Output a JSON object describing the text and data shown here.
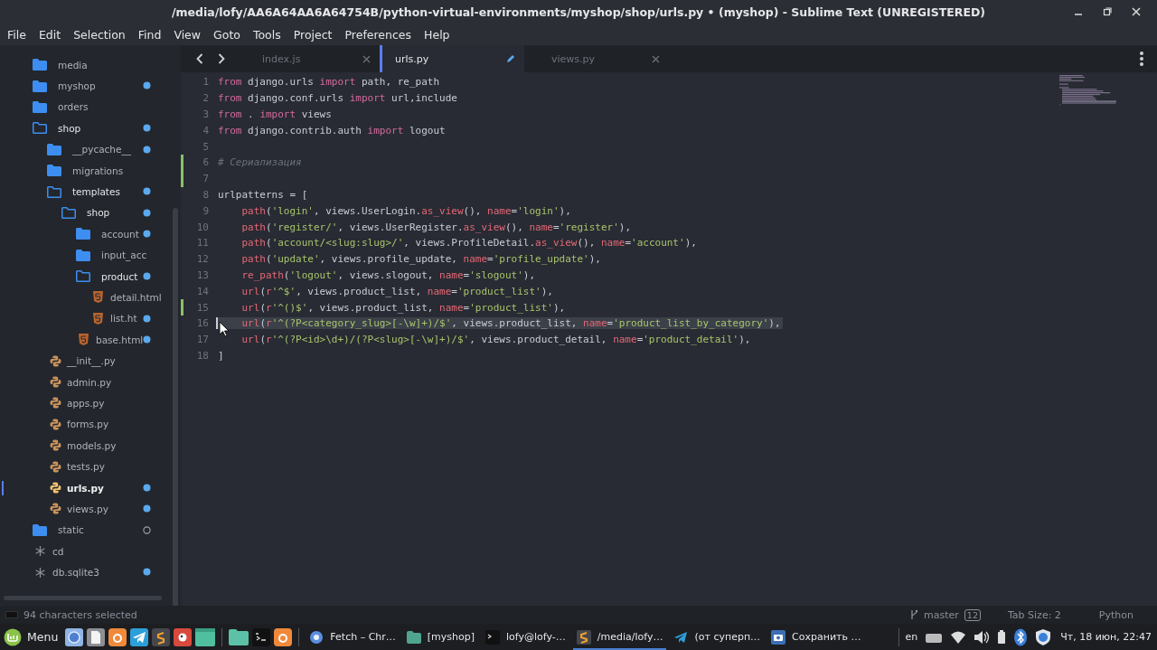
{
  "window": {
    "title": "/media/lofy/AA6A64AA6A64754B/python-virtual-environments/myshop/shop/urls.py • (myshop) - Sublime Text (UNREGISTERED)"
  },
  "menu": [
    "File",
    "Edit",
    "Selection",
    "Find",
    "View",
    "Goto",
    "Tools",
    "Project",
    "Preferences",
    "Help"
  ],
  "sidebar": {
    "items": [
      {
        "label": "media",
        "kind": "folder",
        "modified": false,
        "untracked": false,
        "selected": false
      },
      {
        "label": "myshop",
        "kind": "folder",
        "modified": true,
        "untracked": false,
        "selected": false
      },
      {
        "label": "orders",
        "kind": "folder",
        "modified": false,
        "untracked": false,
        "selected": false
      },
      {
        "label": "shop",
        "kind": "folder_open",
        "modified": true,
        "untracked": false,
        "selected": false,
        "children": [
          {
            "label": "__pycache__",
            "kind": "folder",
            "modified": true,
            "untracked": false,
            "selected": false
          },
          {
            "label": "migrations",
            "kind": "folder",
            "modified": false,
            "untracked": false,
            "selected": false
          },
          {
            "label": "templates",
            "kind": "folder_open",
            "modified": true,
            "untracked": false,
            "selected": false,
            "children": [
              {
                "label": "shop",
                "kind": "folder_open",
                "modified": true,
                "untracked": false,
                "selected": false,
                "children": [
                  {
                    "label": "account",
                    "kind": "folder",
                    "modified": true,
                    "untracked": false,
                    "selected": false
                  },
                  {
                    "label": "input_acc",
                    "kind": "folder",
                    "modified": false,
                    "untracked": false,
                    "selected": false
                  },
                  {
                    "label": "product",
                    "kind": "folder_open",
                    "modified": true,
                    "untracked": false,
                    "selected": false,
                    "children": [
                      {
                        "label": "detail.html",
                        "kind": "html",
                        "modified": false,
                        "untracked": false,
                        "selected": false
                      },
                      {
                        "label": "list.ht",
                        "kind": "html",
                        "modified": true,
                        "untracked": false,
                        "selected": false
                      }
                    ]
                  },
                  {
                    "label": "base.html",
                    "kind": "html",
                    "modified": true,
                    "untracked": false,
                    "selected": false
                  }
                ]
              }
            ]
          },
          {
            "label": "__init__.py",
            "kind": "python",
            "modified": false,
            "untracked": false,
            "selected": false
          },
          {
            "label": "admin.py",
            "kind": "python",
            "modified": false,
            "untracked": false,
            "selected": false
          },
          {
            "label": "apps.py",
            "kind": "python",
            "modified": false,
            "untracked": false,
            "selected": false
          },
          {
            "label": "forms.py",
            "kind": "python",
            "modified": false,
            "untracked": false,
            "selected": false
          },
          {
            "label": "models.py",
            "kind": "python",
            "modified": false,
            "untracked": false,
            "selected": false
          },
          {
            "label": "tests.py",
            "kind": "python",
            "modified": false,
            "untracked": false,
            "selected": false
          },
          {
            "label": "urls.py",
            "kind": "python",
            "modified": true,
            "untracked": false,
            "selected": true
          },
          {
            "label": "views.py",
            "kind": "python",
            "modified": true,
            "untracked": false,
            "selected": false
          }
        ]
      },
      {
        "label": "static",
        "kind": "folder",
        "modified": false,
        "untracked": true,
        "selected": false
      },
      {
        "label": "cd",
        "kind": "file",
        "modified": false,
        "untracked": false,
        "selected": false
      },
      {
        "label": "db.sqlite3",
        "kind": "file",
        "modified": true,
        "untracked": false,
        "selected": false
      }
    ]
  },
  "tabs": [
    {
      "label": "index.js",
      "selected": false,
      "modified": false
    },
    {
      "label": "urls.py",
      "selected": true,
      "modified": true
    },
    {
      "label": "views.py",
      "selected": false,
      "modified": false
    }
  ],
  "editor": {
    "lines": [
      {
        "number": "1",
        "changed": false,
        "segments": [
          {
            "kind": "kw",
            "text": "from"
          },
          {
            "kind": "plain",
            "text": " django.urls "
          },
          {
            "kind": "kw",
            "text": "import"
          },
          {
            "kind": "plain",
            "text": " path, re_path"
          }
        ]
      },
      {
        "number": "2",
        "changed": false,
        "segments": [
          {
            "kind": "kw",
            "text": "from"
          },
          {
            "kind": "plain",
            "text": " django.conf.urls "
          },
          {
            "kind": "kw",
            "text": "import"
          },
          {
            "kind": "plain",
            "text": " url,include"
          }
        ]
      },
      {
        "number": "3",
        "changed": false,
        "segments": [
          {
            "kind": "kw",
            "text": "from"
          },
          {
            "kind": "plain",
            "text": " . "
          },
          {
            "kind": "kw",
            "text": "import"
          },
          {
            "kind": "plain",
            "text": " views"
          }
        ]
      },
      {
        "number": "4",
        "changed": false,
        "segments": [
          {
            "kind": "kw",
            "text": "from"
          },
          {
            "kind": "plain",
            "text": " django.contrib.auth "
          },
          {
            "kind": "kw",
            "text": "import"
          },
          {
            "kind": "plain",
            "text": " logout"
          }
        ]
      },
      {
        "number": "5",
        "changed": false
      },
      {
        "number": "6",
        "changed": true,
        "segments": [
          {
            "kind": "comment",
            "text": "# Сериализация"
          }
        ]
      },
      {
        "number": "7",
        "changed": true
      },
      {
        "number": "8",
        "changed": false,
        "segments": [
          {
            "kind": "plain",
            "text": "urlpatterns = ["
          }
        ]
      },
      {
        "number": "9",
        "changed": false,
        "indented": true,
        "segments": [
          {
            "kind": "fn",
            "text": "path"
          },
          {
            "kind": "plain",
            "text": "("
          },
          {
            "kind": "str",
            "text": "'login'"
          },
          {
            "kind": "plain",
            "text": ", views.UserLogin."
          },
          {
            "kind": "fn",
            "text": "as_view"
          },
          {
            "kind": "plain",
            "text": "(), "
          },
          {
            "kind": "fn",
            "text": "name"
          },
          {
            "kind": "plain",
            "text": "="
          },
          {
            "kind": "str",
            "text": "'login'"
          },
          {
            "kind": "plain",
            "text": "),"
          }
        ]
      },
      {
        "number": "10",
        "changed": false,
        "indented": true,
        "segments": [
          {
            "kind": "fn",
            "text": "path"
          },
          {
            "kind": "plain",
            "text": "("
          },
          {
            "kind": "str",
            "text": "'register/'"
          },
          {
            "kind": "plain",
            "text": ", views.UserRegister."
          },
          {
            "kind": "fn",
            "text": "as_view"
          },
          {
            "kind": "plain",
            "text": "(), "
          },
          {
            "kind": "fn",
            "text": "name"
          },
          {
            "kind": "plain",
            "text": "="
          },
          {
            "kind": "str",
            "text": "'register'"
          },
          {
            "kind": "plain",
            "text": "),"
          }
        ]
      },
      {
        "number": "11",
        "changed": false,
        "indented": true,
        "segments": [
          {
            "kind": "fn",
            "text": "path"
          },
          {
            "kind": "plain",
            "text": "("
          },
          {
            "kind": "str",
            "text": "'account/<slug:slug>/'"
          },
          {
            "kind": "plain",
            "text": ", views.ProfileDetail."
          },
          {
            "kind": "fn",
            "text": "as_view"
          },
          {
            "kind": "plain",
            "text": "(), "
          },
          {
            "kind": "fn",
            "text": "name"
          },
          {
            "kind": "plain",
            "text": "="
          },
          {
            "kind": "str",
            "text": "'account'"
          },
          {
            "kind": "plain",
            "text": "),"
          }
        ]
      },
      {
        "number": "12",
        "changed": false,
        "indented": true,
        "segments": [
          {
            "kind": "fn",
            "text": "path"
          },
          {
            "kind": "plain",
            "text": "("
          },
          {
            "kind": "str",
            "text": "'update'"
          },
          {
            "kind": "plain",
            "text": ", views.profile_update, "
          },
          {
            "kind": "fn",
            "text": "name"
          },
          {
            "kind": "plain",
            "text": "="
          },
          {
            "kind": "str",
            "text": "'profile_update'"
          },
          {
            "kind": "plain",
            "text": "),"
          }
        ]
      },
      {
        "number": "13",
        "changed": false,
        "indented": true,
        "segments": [
          {
            "kind": "fn",
            "text": "re_path"
          },
          {
            "kind": "plain",
            "text": "("
          },
          {
            "kind": "str",
            "text": "'logout'"
          },
          {
            "kind": "plain",
            "text": ", views.slogout, "
          },
          {
            "kind": "fn",
            "text": "name"
          },
          {
            "kind": "plain",
            "text": "="
          },
          {
            "kind": "str",
            "text": "'slogout'"
          },
          {
            "kind": "plain",
            "text": "),"
          }
        ]
      },
      {
        "number": "14",
        "changed": false,
        "indented": true,
        "segments": [
          {
            "kind": "fn",
            "text": "url"
          },
          {
            "kind": "plain",
            "text": "("
          },
          {
            "kind": "fn",
            "text": "r"
          },
          {
            "kind": "str",
            "text": "'^$'"
          },
          {
            "kind": "plain",
            "text": ", views.product_list, "
          },
          {
            "kind": "fn",
            "text": "name"
          },
          {
            "kind": "plain",
            "text": "="
          },
          {
            "kind": "str",
            "text": "'product_list'"
          },
          {
            "kind": "plain",
            "text": "),"
          }
        ]
      },
      {
        "number": "15",
        "changed": true,
        "indented": true,
        "segments": [
          {
            "kind": "fn",
            "text": "url"
          },
          {
            "kind": "plain",
            "text": "("
          },
          {
            "kind": "fn",
            "text": "r"
          },
          {
            "kind": "str",
            "text": "'^()$'"
          },
          {
            "kind": "plain",
            "text": ", views.product_list, "
          },
          {
            "kind": "fn",
            "text": "name"
          },
          {
            "kind": "plain",
            "text": "="
          },
          {
            "kind": "str",
            "text": "'product_list'"
          },
          {
            "kind": "plain",
            "text": "),"
          }
        ]
      },
      {
        "number": "16",
        "changed": false,
        "highlighted": true,
        "indented": true,
        "segments": [
          {
            "kind": "fn",
            "text": "url"
          },
          {
            "kind": "plain",
            "text": "("
          },
          {
            "kind": "fn",
            "text": "r"
          },
          {
            "kind": "str",
            "text": "'^(?P<category_slug>[-\\w]+)/$'"
          },
          {
            "kind": "plain",
            "text": ", views.product_list, "
          },
          {
            "kind": "fn",
            "text": "name"
          },
          {
            "kind": "plain",
            "text": "="
          },
          {
            "kind": "str",
            "text": "'product_list_by_category'"
          },
          {
            "kind": "plain",
            "text": "),"
          }
        ]
      },
      {
        "number": "17",
        "changed": false,
        "indented": true,
        "segments": [
          {
            "kind": "fn",
            "text": "url"
          },
          {
            "kind": "plain",
            "text": "("
          },
          {
            "kind": "fn",
            "text": "r"
          },
          {
            "kind": "str",
            "text": "'^(?P<id>\\d+)/(?P<slug>[-\\w]+)/$'"
          },
          {
            "kind": "plain",
            "text": ", views.product_detail, "
          },
          {
            "kind": "fn",
            "text": "name"
          },
          {
            "kind": "plain",
            "text": "="
          },
          {
            "kind": "str",
            "text": "'product_detail'"
          },
          {
            "kind": "plain",
            "text": "),"
          }
        ]
      },
      {
        "number": "18",
        "changed": false,
        "segments": [
          {
            "kind": "plain",
            "text": "]"
          }
        ]
      }
    ]
  },
  "status_bar": {
    "selection": "94 characters selected",
    "branch": "master",
    "changes": "12",
    "tab_size": "Tab Size: 2",
    "syntax": "Python"
  },
  "taskbar": {
    "menu": "Menu",
    "windows": [
      {
        "kind": "browser",
        "title": "Fetch – Chr…",
        "selected": false
      },
      {
        "kind": "folder",
        "title": "[myshop]",
        "selected": false
      },
      {
        "kind": "terminal",
        "title": "lofy@lofy-…",
        "selected": false
      },
      {
        "kind": "editor",
        "title": "/media/lofy…",
        "selected": true
      },
      {
        "kind": "messenger",
        "title": "(от суперп…",
        "selected": false
      },
      {
        "kind": "camera",
        "title": "Сохранить …",
        "selected": false
      }
    ],
    "keyboard": "en",
    "clock": "Чт, 18 июн, 22:47"
  }
}
